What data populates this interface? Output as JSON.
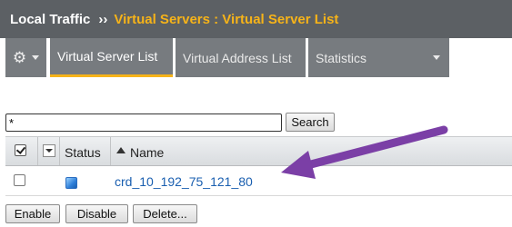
{
  "breadcrumb": {
    "section": "Local Traffic",
    "separator": "››",
    "page": "Virtual Servers : Virtual Server List"
  },
  "tabs": [
    {
      "label": "Virtual Server List",
      "active": true
    },
    {
      "label": "Virtual Address List",
      "active": false
    },
    {
      "label": "Statistics",
      "active": false,
      "has_dropdown": true
    }
  ],
  "gear_menu": {
    "icon": "gear-icon"
  },
  "search": {
    "value": "*",
    "button_label": "Search"
  },
  "table": {
    "columns": {
      "status": "Status",
      "name": "Name"
    },
    "rows": [
      {
        "status": "available (blue)",
        "name": "crd_10_192_75_121_80"
      }
    ]
  },
  "actions": {
    "enable": "Enable",
    "disable": "Disable",
    "delete": "Delete..."
  },
  "colors": {
    "header_bg": "#5c6064",
    "page_title": "#f6b319",
    "tab_bg": "#777b7f",
    "active_tab_underline": "#f6b319",
    "link": "#1a5fb0",
    "annotation_arrow": "#7b3fa6"
  }
}
